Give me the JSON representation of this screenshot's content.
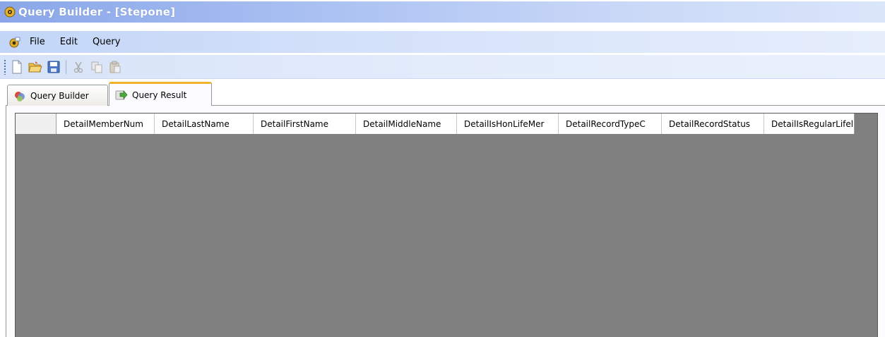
{
  "window": {
    "title": "Query Builder - [Stepone]"
  },
  "menu": {
    "items": [
      "File",
      "Edit",
      "Query"
    ]
  },
  "toolbar": {
    "buttons": [
      "new-document-icon",
      "open-folder-icon",
      "save-icon",
      "cut-icon",
      "copy-icon",
      "paste-icon"
    ]
  },
  "tabs": [
    {
      "label": "Query Builder",
      "active": false,
      "icon": "query-builder-icon"
    },
    {
      "label": "Query Result",
      "active": true,
      "icon": "query-result-icon"
    }
  ],
  "grid": {
    "columns": [
      "DetailMemberNum",
      "DetailLastName",
      "DetailFirstName",
      "DetailMiddleName",
      "DetailIsHonLifeMer",
      "DetailRecordTypeC",
      "DetailRecordStatus",
      "DetailIsRegularLifel"
    ],
    "rows": []
  },
  "colors": {
    "titlebar_start": "#8aa6e8",
    "grid_background": "#808080",
    "active_tab_accent": "#f2b12b"
  }
}
